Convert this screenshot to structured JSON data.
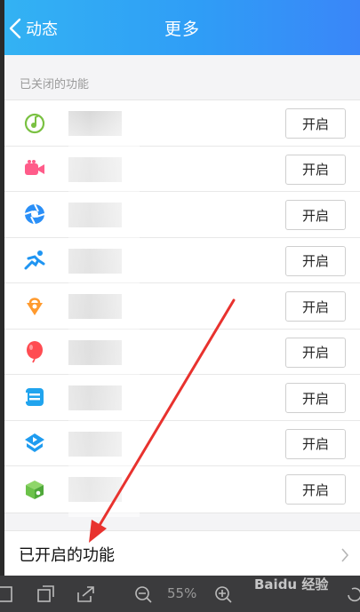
{
  "header": {
    "back_label": "动态",
    "title": "更多"
  },
  "section": {
    "closed_label": "已关闭的功能"
  },
  "features": [
    {
      "icon": "music-note-icon",
      "color": "#7ac142",
      "button": "开启"
    },
    {
      "icon": "video-camera-icon",
      "color": "#ff5c8a",
      "button": "开启"
    },
    {
      "icon": "aperture-icon",
      "color": "#2a8ff7",
      "button": "开启"
    },
    {
      "icon": "runner-icon",
      "color": "#1f95f2",
      "button": "开启"
    },
    {
      "icon": "shopping-bag-icon",
      "color": "#ff9a2e",
      "button": "开启"
    },
    {
      "icon": "balloon-icon",
      "color": "#ff4c52",
      "button": "开启"
    },
    {
      "icon": "document-icon",
      "color": "#20a4ee",
      "button": "开启"
    },
    {
      "icon": "play-course-icon",
      "color": "#1f9cf0",
      "button": "开启"
    },
    {
      "icon": "gift-box-icon",
      "color": "#6cc24a",
      "button": "开启"
    }
  ],
  "enabled": {
    "label": "已开启的功能"
  },
  "toolbar": {
    "zoom": "55%"
  },
  "watermark": {
    "text": "Baidu 经验"
  },
  "colors": {
    "header_start": "#33b2f3",
    "header_end": "#3a86f8",
    "arrow": "#e8322e"
  }
}
